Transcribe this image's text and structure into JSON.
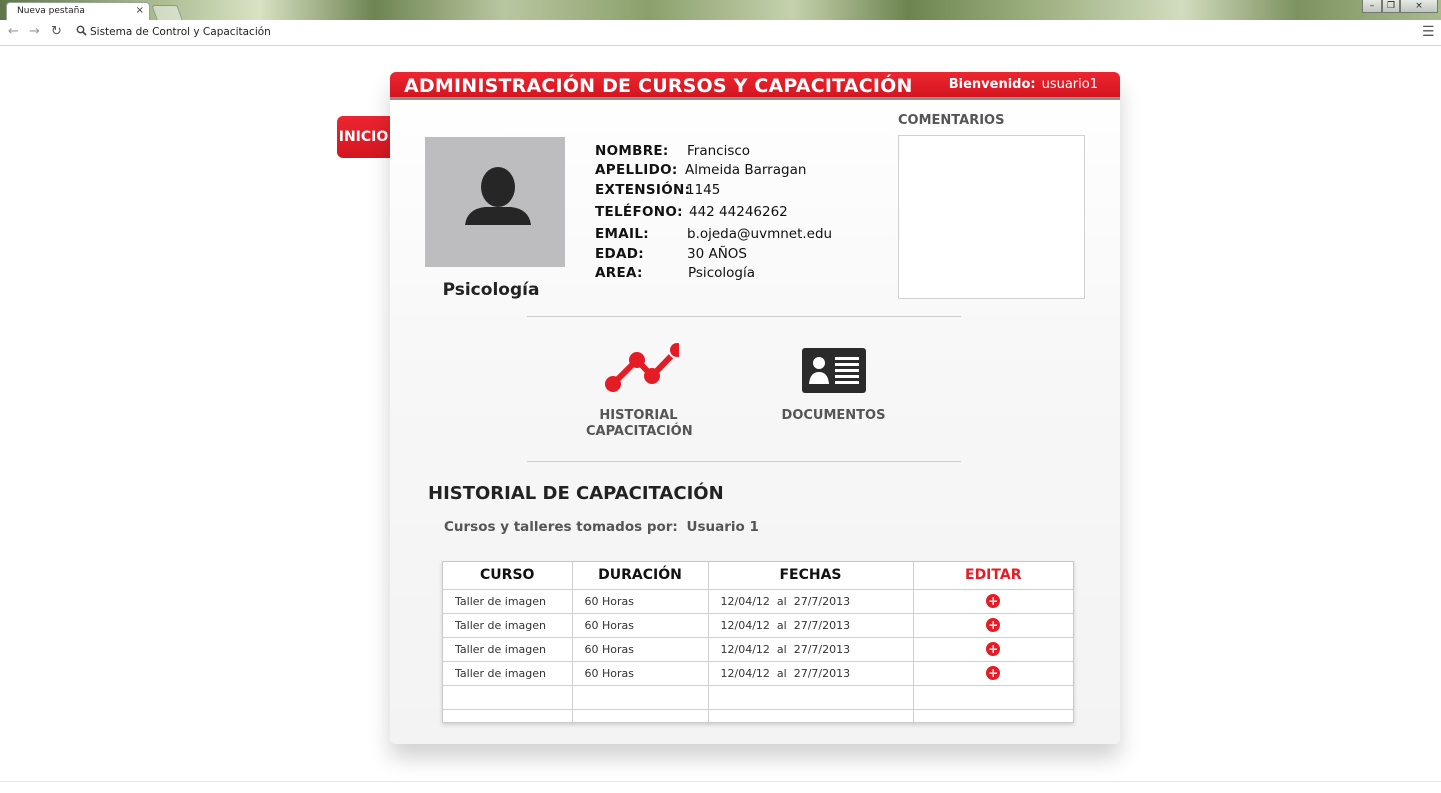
{
  "browser": {
    "tab_title": "Nueva pestaña",
    "tab_close": "×",
    "address": "Sistema de Control y Capacitación",
    "window_minimize": "–",
    "window_restore": "❐",
    "window_close": "×"
  },
  "header": {
    "title": "ADMINISTRACIÓN DE CURSOS Y CAPACITACIÓN",
    "welcome_label": "Bienvenido:",
    "username": "usuario1"
  },
  "side_tab": {
    "label": "INICIO"
  },
  "profile": {
    "department": "Psicología",
    "fields": [
      {
        "label": "NOMBRE:",
        "value": "Francisco"
      },
      {
        "label": "APELLIDO:",
        "value": "Almeida Barragan"
      },
      {
        "label": "EXTENSIÓN:",
        "value": "1145"
      },
      {
        "label": "TELÉFONO:",
        "value": "442 44246262"
      },
      {
        "label": "EMAIL:",
        "value": "b.ojeda@uvmnet.edu"
      },
      {
        "label": "EDAD:",
        "value": "30 AÑOS"
      },
      {
        "label": "AREA:",
        "value": "Psicología"
      }
    ]
  },
  "comments": {
    "label": "COMENTARIOS"
  },
  "nav": {
    "historial_line1": "HISTORIAL",
    "historial_line2": "CAPACITACIÓN",
    "documentos": "DOCUMENTOS"
  },
  "history": {
    "title": "HISTORIAL DE CAPACITACIÓN",
    "subtitle_label": "Cursos y talleres tomados por:",
    "subtitle_user": "Usuario 1",
    "columns": [
      "CURSO",
      "DURACIÓN",
      "FECHAS",
      "EDITAR"
    ],
    "rows": [
      {
        "curso": "Taller de imagen",
        "duracion": "60 Horas",
        "desde": "12/04/12",
        "al": "al",
        "hasta": "27/7/2013"
      },
      {
        "curso": "Taller de imagen",
        "duracion": "60 Horas",
        "desde": "12/04/12",
        "al": "al",
        "hasta": "27/7/2013"
      },
      {
        "curso": "Taller de imagen",
        "duracion": "60 Horas",
        "desde": "12/04/12",
        "al": "al",
        "hasta": "27/7/2013"
      },
      {
        "curso": "Taller de imagen",
        "duracion": "60 Horas",
        "desde": "12/04/12",
        "al": "al",
        "hasta": "27/7/2013"
      }
    ],
    "add_symbol": "+"
  },
  "colors": {
    "accent_red": "#e41c26",
    "header_gray": "#8e8e8e",
    "photo_gray": "#bdbcbe",
    "icon_dark": "#2b2b2b"
  }
}
